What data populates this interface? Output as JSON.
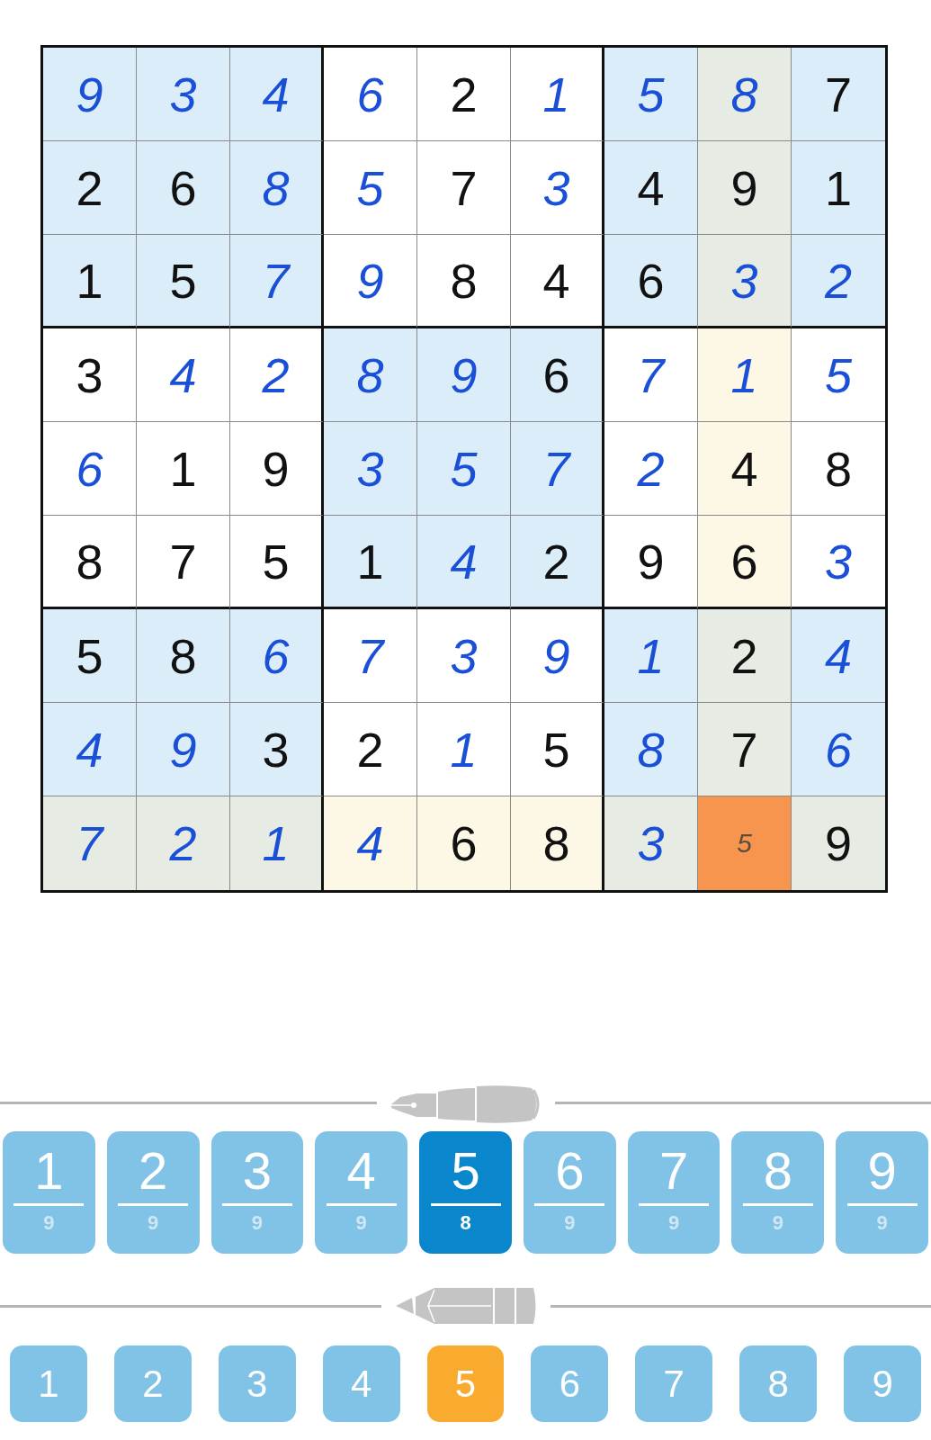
{
  "grid": {
    "rows": [
      {
        "cells": [
          {
            "value": "9",
            "kind": "entered",
            "highlighted": false,
            "selected": false
          },
          {
            "value": "3",
            "kind": "entered",
            "highlighted": false,
            "selected": false
          },
          {
            "value": "4",
            "kind": "entered",
            "highlighted": false,
            "selected": false
          },
          {
            "value": "6",
            "kind": "entered",
            "highlighted": false,
            "selected": false
          },
          {
            "value": "2",
            "kind": "given",
            "highlighted": false,
            "selected": false
          },
          {
            "value": "1",
            "kind": "entered",
            "highlighted": false,
            "selected": false
          },
          {
            "value": "5",
            "kind": "entered",
            "highlighted": false,
            "selected": false
          },
          {
            "value": "8",
            "kind": "entered",
            "highlighted": true,
            "selected": false
          },
          {
            "value": "7",
            "kind": "given",
            "highlighted": false,
            "selected": false
          }
        ]
      },
      {
        "cells": [
          {
            "value": "2",
            "kind": "given",
            "highlighted": false,
            "selected": false
          },
          {
            "value": "6",
            "kind": "given",
            "highlighted": false,
            "selected": false
          },
          {
            "value": "8",
            "kind": "entered",
            "highlighted": false,
            "selected": false
          },
          {
            "value": "5",
            "kind": "entered",
            "highlighted": false,
            "selected": false
          },
          {
            "value": "7",
            "kind": "given",
            "highlighted": false,
            "selected": false
          },
          {
            "value": "3",
            "kind": "entered",
            "highlighted": false,
            "selected": false
          },
          {
            "value": "4",
            "kind": "given",
            "highlighted": false,
            "selected": false
          },
          {
            "value": "9",
            "kind": "given",
            "highlighted": true,
            "selected": false
          },
          {
            "value": "1",
            "kind": "given",
            "highlighted": false,
            "selected": false
          }
        ]
      },
      {
        "cells": [
          {
            "value": "1",
            "kind": "given",
            "highlighted": false,
            "selected": false
          },
          {
            "value": "5",
            "kind": "given",
            "highlighted": false,
            "selected": false
          },
          {
            "value": "7",
            "kind": "entered",
            "highlighted": false,
            "selected": false
          },
          {
            "value": "9",
            "kind": "entered",
            "highlighted": false,
            "selected": false
          },
          {
            "value": "8",
            "kind": "given",
            "highlighted": false,
            "selected": false
          },
          {
            "value": "4",
            "kind": "given",
            "highlighted": false,
            "selected": false
          },
          {
            "value": "6",
            "kind": "given",
            "highlighted": false,
            "selected": false
          },
          {
            "value": "3",
            "kind": "entered",
            "highlighted": true,
            "selected": false
          },
          {
            "value": "2",
            "kind": "entered",
            "highlighted": false,
            "selected": false
          }
        ]
      },
      {
        "cells": [
          {
            "value": "3",
            "kind": "given",
            "highlighted": false,
            "selected": false
          },
          {
            "value": "4",
            "kind": "entered",
            "highlighted": false,
            "selected": false
          },
          {
            "value": "2",
            "kind": "entered",
            "highlighted": false,
            "selected": false
          },
          {
            "value": "8",
            "kind": "entered",
            "highlighted": false,
            "selected": false
          },
          {
            "value": "9",
            "kind": "entered",
            "highlighted": false,
            "selected": false
          },
          {
            "value": "6",
            "kind": "given",
            "highlighted": false,
            "selected": false
          },
          {
            "value": "7",
            "kind": "entered",
            "highlighted": false,
            "selected": false
          },
          {
            "value": "1",
            "kind": "entered",
            "highlighted": true,
            "selected": false
          },
          {
            "value": "5",
            "kind": "entered",
            "highlighted": false,
            "selected": false
          }
        ]
      },
      {
        "cells": [
          {
            "value": "6",
            "kind": "entered",
            "highlighted": false,
            "selected": false
          },
          {
            "value": "1",
            "kind": "given",
            "highlighted": false,
            "selected": false
          },
          {
            "value": "9",
            "kind": "given",
            "highlighted": false,
            "selected": false
          },
          {
            "value": "3",
            "kind": "entered",
            "highlighted": false,
            "selected": false
          },
          {
            "value": "5",
            "kind": "entered",
            "highlighted": false,
            "selected": false
          },
          {
            "value": "7",
            "kind": "entered",
            "highlighted": false,
            "selected": false
          },
          {
            "value": "2",
            "kind": "entered",
            "highlighted": false,
            "selected": false
          },
          {
            "value": "4",
            "kind": "given",
            "highlighted": true,
            "selected": false
          },
          {
            "value": "8",
            "kind": "given",
            "highlighted": false,
            "selected": false
          }
        ]
      },
      {
        "cells": [
          {
            "value": "8",
            "kind": "given",
            "highlighted": false,
            "selected": false
          },
          {
            "value": "7",
            "kind": "given",
            "highlighted": false,
            "selected": false
          },
          {
            "value": "5",
            "kind": "given",
            "highlighted": false,
            "selected": false
          },
          {
            "value": "1",
            "kind": "given",
            "highlighted": false,
            "selected": false
          },
          {
            "value": "4",
            "kind": "entered",
            "highlighted": false,
            "selected": false
          },
          {
            "value": "2",
            "kind": "given",
            "highlighted": false,
            "selected": false
          },
          {
            "value": "9",
            "kind": "given",
            "highlighted": false,
            "selected": false
          },
          {
            "value": "6",
            "kind": "given",
            "highlighted": true,
            "selected": false
          },
          {
            "value": "3",
            "kind": "entered",
            "highlighted": false,
            "selected": false
          }
        ]
      },
      {
        "cells": [
          {
            "value": "5",
            "kind": "given",
            "highlighted": false,
            "selected": false
          },
          {
            "value": "8",
            "kind": "given",
            "highlighted": false,
            "selected": false
          },
          {
            "value": "6",
            "kind": "entered",
            "highlighted": false,
            "selected": false
          },
          {
            "value": "7",
            "kind": "entered",
            "highlighted": false,
            "selected": false
          },
          {
            "value": "3",
            "kind": "entered",
            "highlighted": false,
            "selected": false
          },
          {
            "value": "9",
            "kind": "entered",
            "highlighted": false,
            "selected": false
          },
          {
            "value": "1",
            "kind": "entered",
            "highlighted": false,
            "selected": false
          },
          {
            "value": "2",
            "kind": "given",
            "highlighted": true,
            "selected": false
          },
          {
            "value": "4",
            "kind": "entered",
            "highlighted": false,
            "selected": false
          }
        ]
      },
      {
        "cells": [
          {
            "value": "4",
            "kind": "entered",
            "highlighted": false,
            "selected": false
          },
          {
            "value": "9",
            "kind": "entered",
            "highlighted": false,
            "selected": false
          },
          {
            "value": "3",
            "kind": "given",
            "highlighted": false,
            "selected": false
          },
          {
            "value": "2",
            "kind": "given",
            "highlighted": false,
            "selected": false
          },
          {
            "value": "1",
            "kind": "entered",
            "highlighted": false,
            "selected": false
          },
          {
            "value": "5",
            "kind": "given",
            "highlighted": false,
            "selected": false
          },
          {
            "value": "8",
            "kind": "entered",
            "highlighted": false,
            "selected": false
          },
          {
            "value": "7",
            "kind": "given",
            "highlighted": true,
            "selected": false
          },
          {
            "value": "6",
            "kind": "entered",
            "highlighted": false,
            "selected": false
          }
        ]
      },
      {
        "cells": [
          {
            "value": "7",
            "kind": "entered",
            "highlighted": true,
            "selected": false
          },
          {
            "value": "2",
            "kind": "entered",
            "highlighted": true,
            "selected": false
          },
          {
            "value": "1",
            "kind": "entered",
            "highlighted": true,
            "selected": false
          },
          {
            "value": "4",
            "kind": "entered",
            "highlighted": true,
            "selected": false
          },
          {
            "value": "6",
            "kind": "given",
            "highlighted": true,
            "selected": false
          },
          {
            "value": "8",
            "kind": "given",
            "highlighted": true,
            "selected": false
          },
          {
            "value": "3",
            "kind": "entered",
            "highlighted": true,
            "selected": false
          },
          {
            "value": "5",
            "kind": "note",
            "selected": true
          },
          {
            "value": "9",
            "kind": "given",
            "highlighted": true,
            "selected": false
          }
        ]
      }
    ]
  },
  "pen_pad": {
    "buttons": [
      {
        "digit": "1",
        "count": "9",
        "selected": false
      },
      {
        "digit": "2",
        "count": "9",
        "selected": false
      },
      {
        "digit": "3",
        "count": "9",
        "selected": false
      },
      {
        "digit": "4",
        "count": "9",
        "selected": false
      },
      {
        "digit": "5",
        "count": "8",
        "selected": true
      },
      {
        "digit": "6",
        "count": "9",
        "selected": false
      },
      {
        "digit": "7",
        "count": "9",
        "selected": false
      },
      {
        "digit": "8",
        "count": "9",
        "selected": false
      },
      {
        "digit": "9",
        "count": "9",
        "selected": false
      }
    ]
  },
  "pencil_pad": {
    "buttons": [
      {
        "digit": "1",
        "selected": false
      },
      {
        "digit": "2",
        "selected": false
      },
      {
        "digit": "3",
        "selected": false
      },
      {
        "digit": "4",
        "selected": false
      },
      {
        "digit": "5",
        "selected": true
      },
      {
        "digit": "6",
        "selected": false
      },
      {
        "digit": "7",
        "selected": false
      },
      {
        "digit": "8",
        "selected": false
      },
      {
        "digit": "9",
        "selected": false
      }
    ]
  }
}
